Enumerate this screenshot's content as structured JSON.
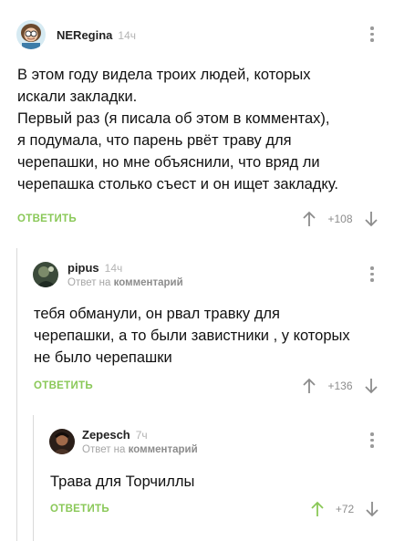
{
  "comments": [
    {
      "username": "NERegina",
      "time": "14ч",
      "text": "В этом году видела троих людей, которых\nискали закладки.\nПервый раз (я писала об этом в комментах),\nя подумала, что парень рвёт траву для\nчерепашки, но мне объяснили, что вряд ли\nчерепашка столько съест и он ищет закладку.",
      "reply_label": "ОТВЕТИТЬ",
      "rating": "+108"
    },
    {
      "username": "pipus",
      "time": "14ч",
      "reply_prefix": "Ответ на",
      "reply_target": "комментарий",
      "text": "тебя обманули, он рвал травку для\nчерепашки, а то были завистники , у которых\nне было черепашки",
      "reply_label": "ОТВЕТИТЬ",
      "rating": "+136"
    },
    {
      "username": "Zepesch",
      "time": "7ч",
      "reply_prefix": "Ответ на",
      "reply_target": "комментарий",
      "text": "Трава для Торчиллы",
      "reply_label": "ОТВЕТИТЬ",
      "rating": "+72"
    }
  ],
  "colors": {
    "accent_green": "#8ac858",
    "upvoted_green": "#8ac858",
    "muted": "#9a9a9a",
    "thread_line": "#d9d9d9"
  },
  "icons": [
    "avatar-neregina",
    "avatar-pipus",
    "avatar-zepesch",
    "more-vertical-icon",
    "arrow-up-icon",
    "arrow-down-icon"
  ]
}
